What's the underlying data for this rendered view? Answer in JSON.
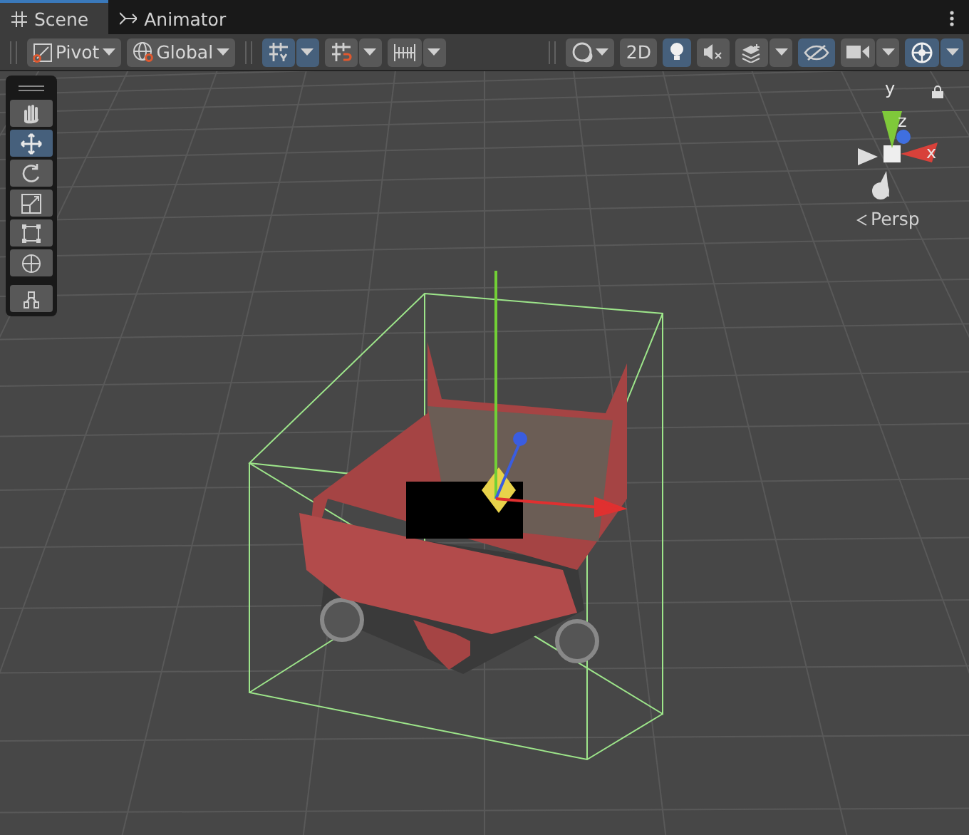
{
  "tabs": [
    {
      "label": "Scene",
      "selected": true
    },
    {
      "label": "Animator",
      "selected": false
    }
  ],
  "toolbar_left": [
    {
      "kind": "dropdown",
      "label": "Pivot",
      "selected": false
    },
    {
      "kind": "dropdown",
      "label": "Global",
      "selected": false
    },
    {
      "kind": "split",
      "selected": true
    },
    {
      "kind": "split",
      "selected": false
    },
    {
      "kind": "split",
      "selected": false
    }
  ],
  "toolbar_right": [
    {
      "kind": "dropdown",
      "selected": false
    },
    {
      "kind": "toggle",
      "label": "2D",
      "selected": false
    },
    {
      "kind": "toggle",
      "selected": true
    },
    {
      "kind": "toggle",
      "selected": false
    },
    {
      "kind": "split",
      "selected": false
    },
    {
      "kind": "toggle",
      "selected": true
    },
    {
      "kind": "split",
      "selected": false
    },
    {
      "kind": "split",
      "selected": true
    }
  ],
  "tools": [
    {
      "selected": false
    },
    {
      "selected": true
    },
    {
      "selected": false
    },
    {
      "selected": false
    },
    {
      "selected": false
    },
    {
      "selected": false
    },
    {
      "selected": false
    }
  ],
  "orientation_gizmo": {
    "axes": [
      {
        "label": "y",
        "color": "#7fc93a"
      },
      {
        "label": "z",
        "color": "#3f6fe0"
      },
      {
        "label": "x",
        "color": "#d8413a"
      }
    ],
    "projection": "Persp"
  }
}
